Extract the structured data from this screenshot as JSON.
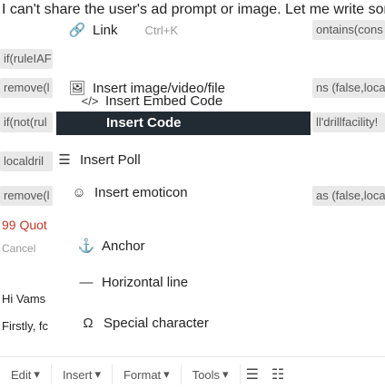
{
  "header_text": "I can't share the user's ad prompt or image. Let me write something about the…",
  "background": {
    "left_chips": [
      "if(ruleIAF",
      "remove(l",
      "if(not(rul",
      "localdril",
      "remove(l"
    ],
    "right_chips": [
      "ontains(cons",
      "ns (false,loca",
      "ll'drillfacility!",
      "as (false,loca"
    ],
    "quote_label": "99 Quot",
    "cancel_label": "Cancel",
    "note1": "Hi Vams",
    "note2": "Firstly, fc"
  },
  "menu": {
    "items": [
      {
        "label": "Link",
        "icon": "link-icon",
        "shortcut": "Ctrl+K"
      },
      {
        "label": "Insert image/video/file",
        "icon": "image-icon"
      },
      {
        "label": "Insert Embed Code",
        "icon": "code-icon"
      },
      {
        "label": "Insert Code",
        "icon": "code-block-icon",
        "highlighted": true
      },
      {
        "label": "Insert Poll",
        "icon": "poll-icon"
      },
      {
        "label": "Insert emoticon",
        "icon": "emoticon-icon"
      },
      {
        "label": "Anchor",
        "icon": "anchor-icon"
      },
      {
        "label": "Horizontal line",
        "icon": "horizontal-line-icon"
      },
      {
        "label": "Special character",
        "icon": "special-character-icon"
      }
    ]
  },
  "toolbar": {
    "edit": "Edit",
    "insert": "Insert",
    "format": "Format",
    "tools": "Tools"
  }
}
